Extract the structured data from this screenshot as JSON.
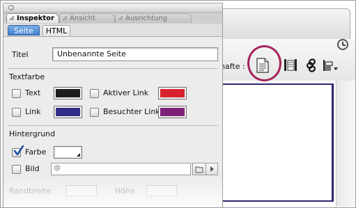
{
  "document_window": {
    "toolbar_label": "hafte",
    "toolbar_separator": ":",
    "toolbar_icons": [
      "page-properties-icon",
      "code-split-icon",
      "link-chain-icon",
      "align-dropdown-icon"
    ],
    "clock_icon": "history-clock-icon",
    "highlight_color": "#a4245a"
  },
  "inspector": {
    "tabs": [
      {
        "label": "Inspektor",
        "active": true
      },
      {
        "label": "Ansicht",
        "active": false
      },
      {
        "label": "Ausrichtung",
        "active": false
      }
    ],
    "subtabs": [
      {
        "label": "Seite",
        "active": true
      },
      {
        "label": "HTML",
        "active": false
      }
    ],
    "title_label": "Titel",
    "title_value": "Unbenannte Seite",
    "text_color_section": "Textfarbe",
    "text_colors": {
      "text": {
        "label": "Text",
        "checked": false,
        "color": "#1c1c1c"
      },
      "active_link": {
        "label": "Aktiver Link",
        "checked": false,
        "color": "#d8232f"
      },
      "link": {
        "label": "Link",
        "checked": false,
        "color": "#2e2c86"
      },
      "visited_link": {
        "label": "Besuchter Link",
        "checked": false,
        "color": "#7d2276"
      }
    },
    "background_section": "Hintergrund",
    "background_color": {
      "label": "Farbe",
      "checked": true,
      "color": "#ffffff"
    },
    "background_image": {
      "label": "Bild",
      "checked": false,
      "value": "",
      "at_symbol": "@"
    },
    "margin_width_label": "Randbreite",
    "margin_height_label": "Höhe"
  },
  "colors": {
    "selection_blue": "#4a86d6",
    "checkmark_blue": "#1f4fa8",
    "panel_bg": "#ececec"
  }
}
